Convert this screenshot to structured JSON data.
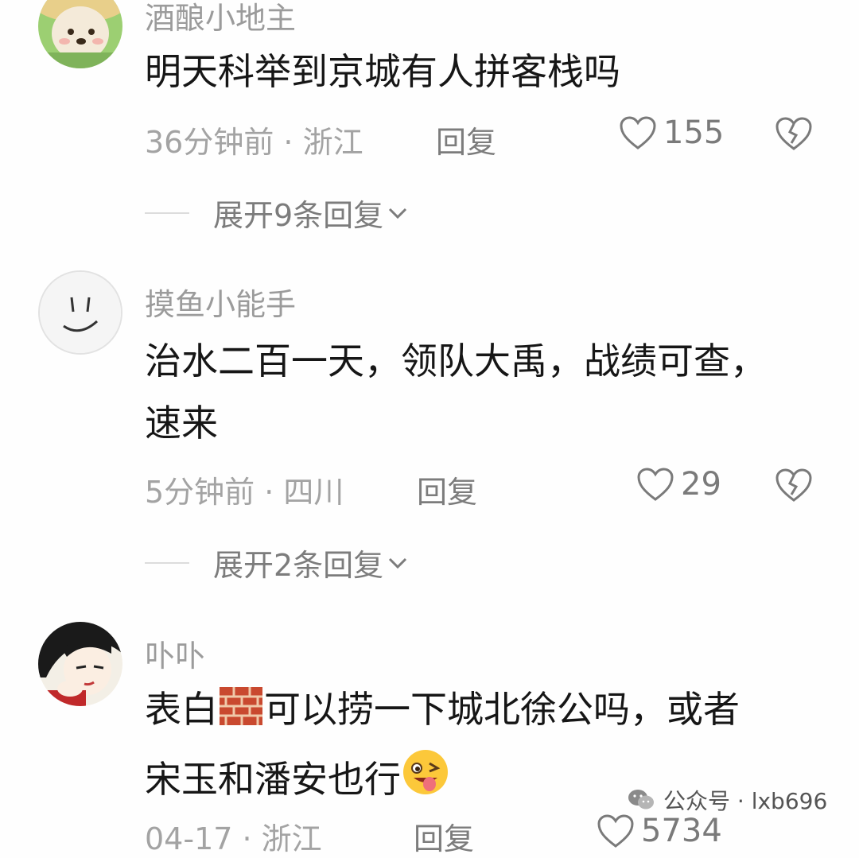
{
  "comments": [
    {
      "username": "酒酿小地主",
      "text_lines": [
        "明天科举到京城有人拼客栈吗"
      ],
      "time_location": "36分钟前 · 浙江",
      "reply_label": "回复",
      "likes": "155",
      "expand_label": "展开9条回复"
    },
    {
      "username": "摸鱼小能手",
      "text_lines": [
        "治水二百一天，领队大禹，战绩可查，",
        "速来"
      ],
      "time_location": "5分钟前 · 四川",
      "reply_label": "回复",
      "likes": "29",
      "expand_label": "展开2条回复"
    },
    {
      "username": "卟卟",
      "text_line1_before": "表白",
      "text_line1_after": "可以捞一下城北徐公吗，或者",
      "text_line2": "宋玉和潘安也行",
      "time_location": "04-17 · 浙江",
      "reply_label": "回复",
      "likes": "5734"
    }
  ],
  "watermark": {
    "label": "公众号 · lxb696"
  },
  "icons": {
    "like": "heart-outline-icon",
    "dislike": "broken-heart-icon",
    "expand": "chevron-down-icon",
    "emoji_wall": "brick-wall-emoji",
    "emoji_wink": "winking-tongue-emoji",
    "watermark": "wechat-icon"
  },
  "colors": {
    "background": "#fefefe",
    "text": "#161616",
    "secondary": "#9b9b9b",
    "icon": "#7a7a7a"
  }
}
